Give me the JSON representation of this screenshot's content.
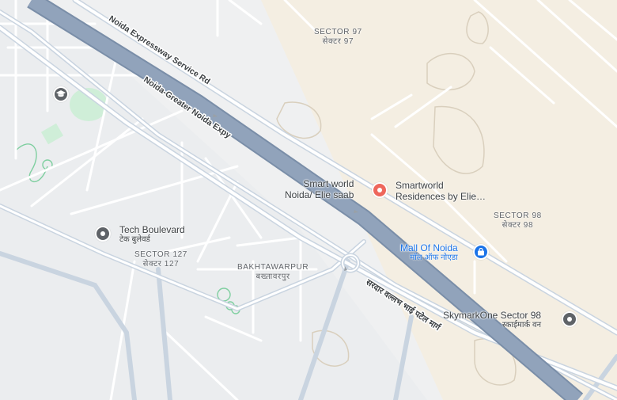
{
  "map": {
    "roads": [
      {
        "name": "Noida Expressway Service Rd"
      },
      {
        "name": "Noida-Greater Noida Expy"
      },
      {
        "name": "सरदार वल्लभ भाई पटेल मार्ग"
      }
    ],
    "areas": [
      {
        "name": "SECTOR 97",
        "local": "सेक्टर 97"
      },
      {
        "name": "SECTOR 98",
        "local": "सेक्टर 98"
      },
      {
        "name": "SECTOR 127",
        "local": "सेक्टर 127"
      },
      {
        "name": "BAKHTAWARPUR",
        "local": "बख्तावरपुर"
      }
    ],
    "places": [
      {
        "name": "Smart world Noida/ Elie saab",
        "line1": "Smart world",
        "line2": "Noida/ Elie saab",
        "icon": "location-pin-icon",
        "color": "#ee675c"
      },
      {
        "name": "Smartworld Residences by Elie...",
        "line1": "Smartworld",
        "line2": "Residences by Elie…",
        "icon": "location-pin-icon",
        "color": "#ee675c"
      },
      {
        "name": "Tech Boulevard",
        "local": "टेक बुलेवर्ड",
        "icon": "place-pin-icon",
        "color": "#5f6368"
      },
      {
        "name": "Mall Of Noida",
        "local": "मॉल ऑफ नोएडा",
        "icon": "shopping-bag-icon",
        "color": "#1a73e8"
      },
      {
        "name": "SkymarkOne Sector 98",
        "local": "स्काईमार्क वन",
        "icon": "place-pin-icon",
        "color": "#5f6368"
      },
      {
        "name": "",
        "icon": "school-icon",
        "color": "#5f6368"
      }
    ],
    "colors": {
      "land": "#f4eee2",
      "urban": "#f1f3f4",
      "expressway": "#8ea2bd",
      "road": "#ffffff",
      "park": "#d2f2dc"
    }
  }
}
